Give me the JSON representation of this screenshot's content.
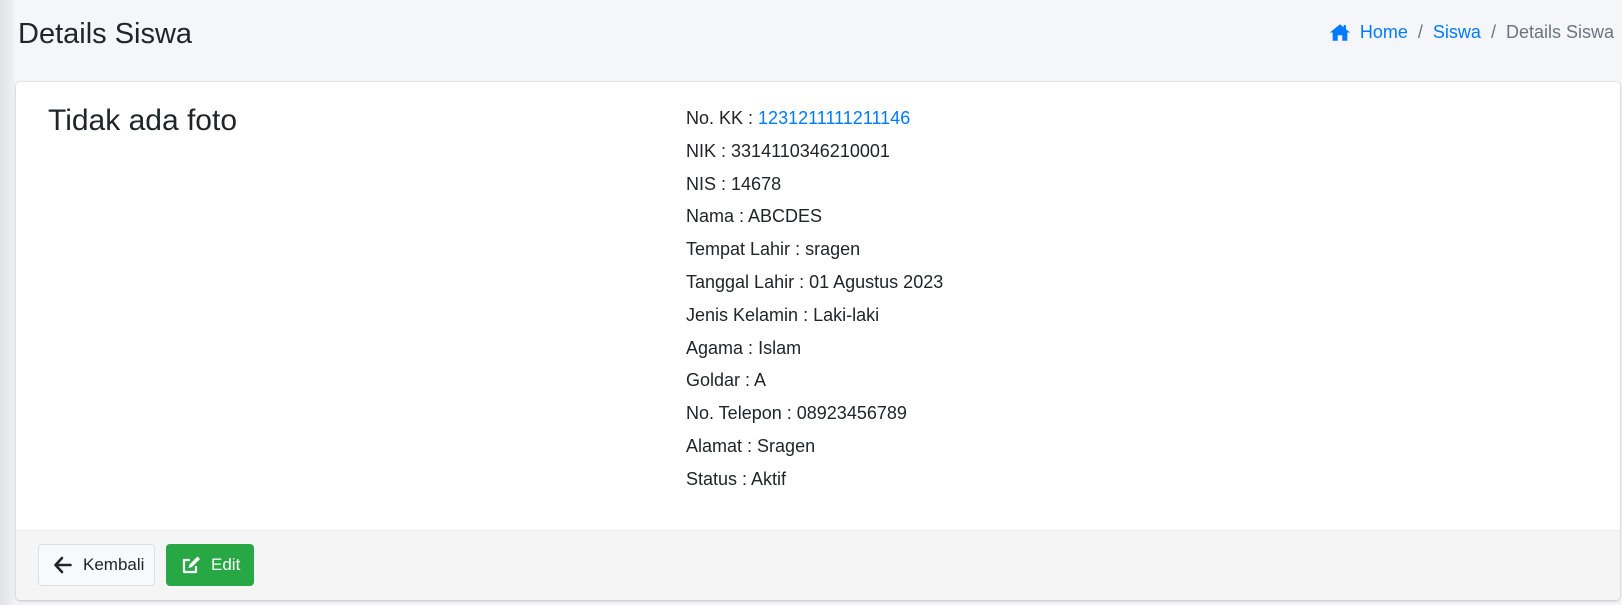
{
  "header": {
    "title": "Details Siswa",
    "breadcrumb": {
      "home": "Home",
      "parent": "Siswa",
      "current": "Details Siswa",
      "separator": "/"
    }
  },
  "main": {
    "photo_text": "Tidak ada foto",
    "details": [
      {
        "label": "No. KK",
        "value": "1231211111211146"
      },
      {
        "label": "NIK",
        "value": "3314110346210001"
      },
      {
        "label": "NIS",
        "value": "14678"
      },
      {
        "label": "Nama",
        "value": "ABCDES"
      },
      {
        "label": "Tempat Lahir",
        "value": "sragen"
      },
      {
        "label": "Tanggal Lahir",
        "value": "01 Agustus 2023"
      },
      {
        "label": "Jenis Kelamin",
        "value": "Laki-laki"
      },
      {
        "label": "Agama",
        "value": "Islam"
      },
      {
        "label": "Goldar",
        "value": "A"
      },
      {
        "label": "No. Telepon",
        "value": "08923456789"
      },
      {
        "label": "Alamat",
        "value": "Sragen"
      },
      {
        "label": "Status",
        "value": "Aktif"
      }
    ]
  },
  "footer": {
    "back_label": "Kembali",
    "edit_label": "Edit"
  },
  "icons": {
    "home": "home-icon",
    "back": "arrow-left-icon",
    "edit": "edit-icon"
  },
  "colors": {
    "link": "#007bff",
    "success": "#28a745",
    "muted": "#6c757d"
  }
}
